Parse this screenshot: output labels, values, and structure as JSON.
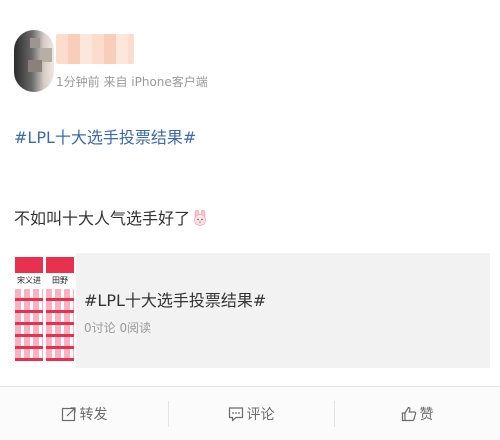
{
  "post": {
    "meta": "1分钟前 来自 iPhone客户端",
    "hashtag": "#LPL十大选手投票结果#",
    "text": "不如叫十大人气选手好了",
    "emoji_icon": "bunny-emoji-icon"
  },
  "link_card": {
    "thumbnail": {
      "left_label": "宋义进",
      "right_label": "田野"
    },
    "title": "#LPL十大选手投票结果#",
    "stats": "0讨论 0阅读"
  },
  "actions": {
    "forward_label": "转发",
    "comment_label": "评论",
    "like_label": "赞"
  },
  "colors": {
    "hashtag": "#3f6aa5",
    "thumb_accent": "#e8304f"
  }
}
